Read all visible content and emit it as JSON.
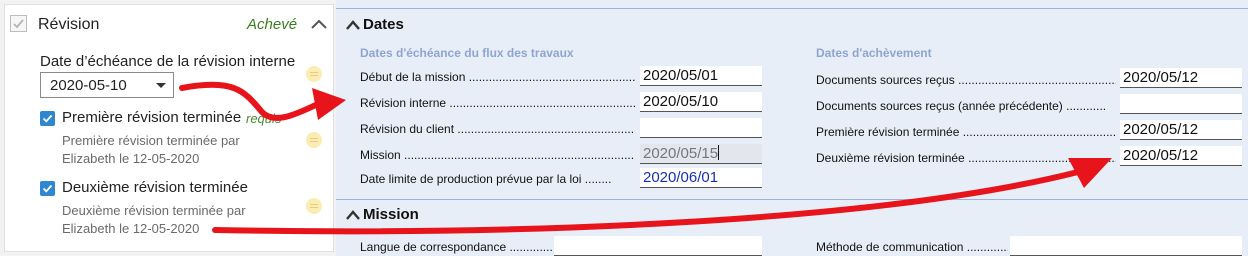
{
  "left_panel": {
    "title": "Révision",
    "status": "Achevé",
    "due_date_label": "Date d’échéance de la révision interne",
    "due_date_value": "2020-05-10",
    "first_review": {
      "label": "Première révision terminée",
      "required": "requis",
      "by_line1": "Première révision terminée par",
      "by_line2": "Elizabeth le 12-05-2020"
    },
    "second_review": {
      "label": "Deuxième révision terminée",
      "by_line1": "Deuxième révision terminée par",
      "by_line2": "Elizabeth le 12-05-2020"
    }
  },
  "form": {
    "dates_section": "Dates",
    "left_group_title": "Dates d'échéance du flux des travaux",
    "right_group_title": "Dates d'achèvement",
    "left_rows": [
      {
        "label": "Début de la mission",
        "value": "2020/05/01"
      },
      {
        "label": "Révision interne",
        "value": "2020/05/10"
      },
      {
        "label": "Révision du client",
        "value": ""
      },
      {
        "label": "Mission",
        "value": "2020/05/15"
      },
      {
        "label": "Date limite de production prévue par la loi",
        "value": "2020/06/01"
      }
    ],
    "right_rows": [
      {
        "label": "Documents sources reçus",
        "value": "2020/05/12"
      },
      {
        "label": "Documents sources reçus (année précédente)",
        "value": ""
      },
      {
        "label": "Première révision terminée",
        "value": "2020/05/12"
      },
      {
        "label": "Deuxième révision terminée",
        "value": "2020/05/12"
      }
    ],
    "mission_section": "Mission",
    "mission_rows": [
      {
        "label": "Langue de correspondance",
        "value": ""
      },
      {
        "label": "Méthode de communication",
        "value": ""
      }
    ]
  },
  "colors": {
    "status_green": "#3a7d1e",
    "checkbox_blue": "#2f87d0",
    "group_title_blue": "#8ea6cf",
    "arrow_red": "#e8141b",
    "legal_date_blue": "#1a2fb0"
  }
}
